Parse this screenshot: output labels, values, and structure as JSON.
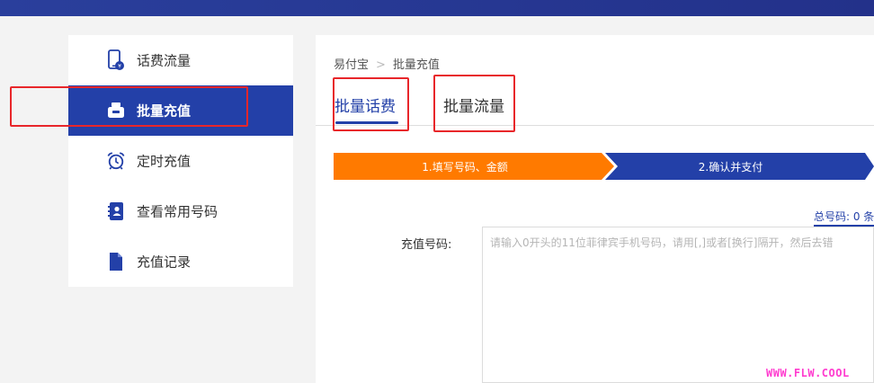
{
  "colors": {
    "brand_blue": "#2340a8",
    "step_orange": "#ff7a00",
    "annotation_red": "#e8262a",
    "watermark_pink": "#ff3ccf"
  },
  "sidebar": {
    "items": [
      {
        "label": "话费流量",
        "icon": "phone-recharge-icon"
      },
      {
        "label": "批量充值",
        "icon": "printer-icon",
        "active": true
      },
      {
        "label": "定时充值",
        "icon": "alarm-clock-icon"
      },
      {
        "label": "查看常用号码",
        "icon": "contact-book-icon"
      },
      {
        "label": "充值记录",
        "icon": "document-icon"
      }
    ]
  },
  "breadcrumb": {
    "home": "易付宝",
    "separator": ">",
    "current": "批量充值"
  },
  "tabs": [
    {
      "label": "批量话费",
      "active": true
    },
    {
      "label": "批量流量",
      "active": false
    }
  ],
  "steps": [
    {
      "label": "1.填写号码、金额",
      "active": true
    },
    {
      "label": "2.确认并支付",
      "active": false
    }
  ],
  "form": {
    "count_text": "总号码: 0 条",
    "phone_label": "充值号码:",
    "phone_placeholder": "请输入0开头的11位菲律宾手机号码，请用[,]或者[换行]隔开，然后去错",
    "phone_value": ""
  },
  "watermark": "WWW.FLW.COOL"
}
